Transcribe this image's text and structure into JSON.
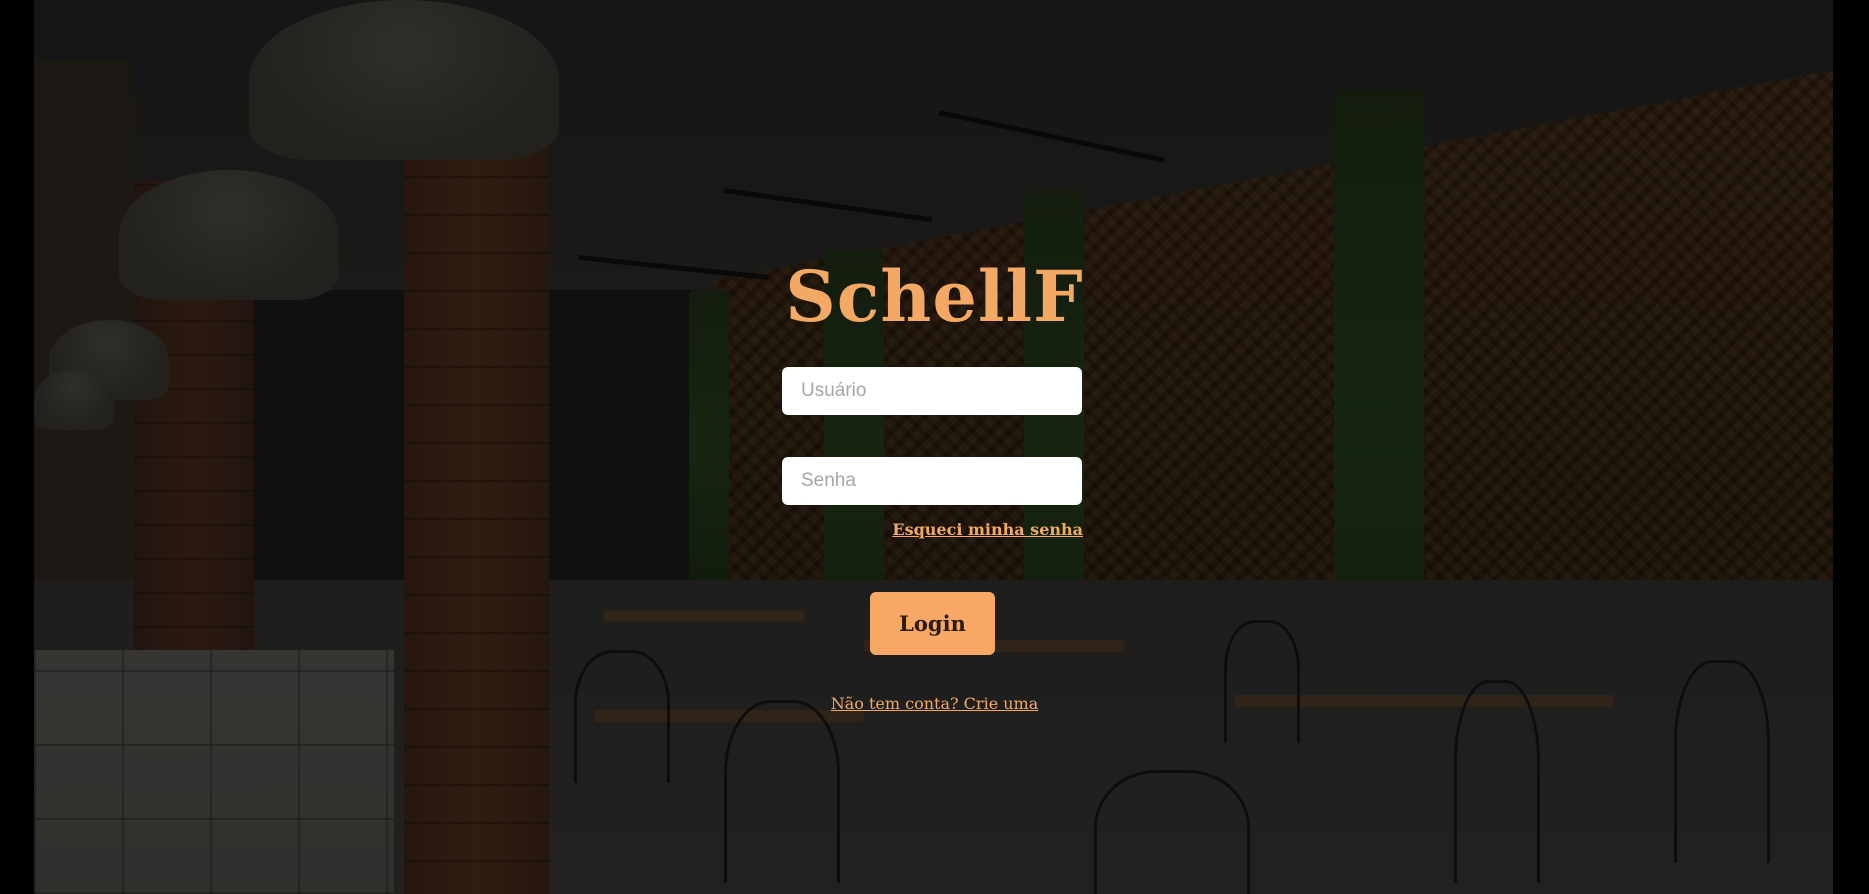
{
  "app": {
    "brand": "SchellF"
  },
  "login_form": {
    "username_placeholder": "Usuário",
    "username_value": "",
    "password_placeholder": "Senha",
    "password_value": "",
    "forgot_password_link": "Esqueci minha senha",
    "login_button": "Login",
    "signup_link": "Não tem conta? Crie uma"
  },
  "colors": {
    "accent": "#f3a964",
    "button_bg": "#f7a864",
    "input_bg": "#ffffff",
    "page_frame": "#000000"
  }
}
